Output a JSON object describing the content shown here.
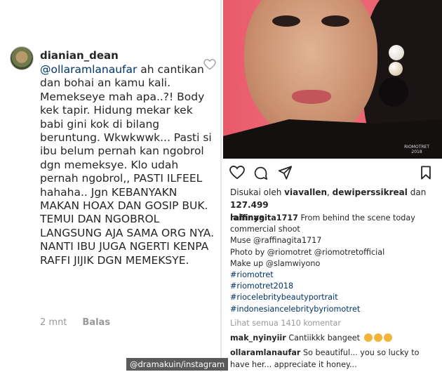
{
  "left_comment": {
    "username": "dianian_dean",
    "mention": "@ollaramlanaufar",
    "text": " ah cantikan dan bohai an kamu kali. Memekseye mah apa..?! Body kek tapir. Hidung mekar kek babi gini kok di bilang beruntung. Wkwkwwk... Pasti si ibu belum pernah kan ngobrol dgn memeksye. Klo udah pernah ngobrol,, PASTI ILFEEL hahaha.. Jgn KEBANYAKN MAKAN HOAX DAN GOSIP BUK. TEMUI DAN NGOBROL LANGSUNG AJA SAMA ORG NYA. NANTI IBU JUGA NGERTI KENPA RAFFI JIJIK DGN MEMEKSYE.",
    "time": "2 mnt",
    "reply_label": "Balas"
  },
  "post": {
    "photo_credit_brand": "RIOMOTRET",
    "photo_credit_year": "2018",
    "likes_prefix": "Disukai oleh ",
    "liker_1": "viavallen",
    "liker_2": "dewiperssikreal",
    "likes_mid": " dan ",
    "likes_count": "127.499",
    "likes_suffix": "lainnya",
    "caption_user": "raffinagita1717",
    "caption_lines": [
      "From behind the scene today commercial shoot",
      "Muse @raffinagita1717",
      "Photo by @riomotret @riomotretofficial",
      "Make up @slamwiyono",
      "#riomotret",
      "#riomotret2018",
      "#riocelebritybeautyportrait",
      "#indonesiancelebritybyriomotret"
    ],
    "view_all": "Lihat semua 1410 komentar",
    "comments": [
      {
        "user": "mak_nyinyiir",
        "text": "Cantiikkk bangeet"
      },
      {
        "user": "ollaramlanaufar",
        "text": "So beautiful... you so lucky to have her... appreciate it honey..."
      }
    ]
  },
  "watermark": "@dramakuin/instagram",
  "icons": [
    "heart-outline-icon",
    "comment-bubble-icon",
    "share-plane-icon",
    "bookmark-icon",
    "avatar"
  ],
  "colors": {
    "link": "#003569",
    "muted": "#999999",
    "photo_bg": "#e8596a"
  }
}
